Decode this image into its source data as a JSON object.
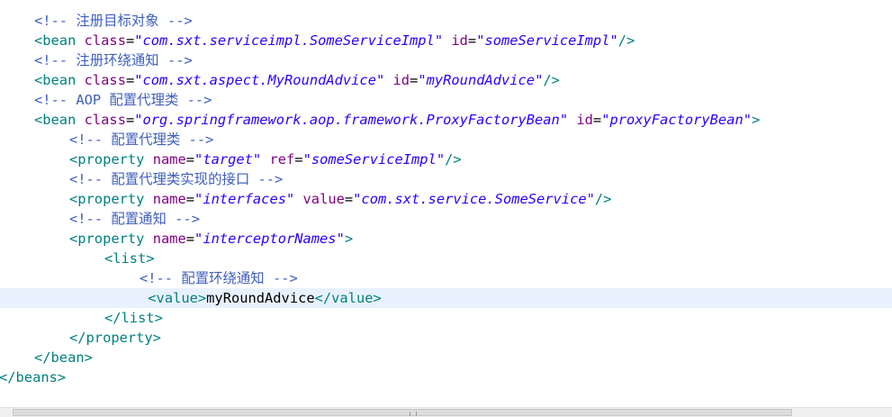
{
  "lines": [
    {
      "indent": 2,
      "segs": [
        {
          "k": "c",
          "t": "<!-- 注册目标对象 -->"
        }
      ]
    },
    {
      "indent": 2,
      "segs": [
        {
          "k": "t",
          "t": "<bean"
        },
        {
          "k": "x",
          "t": " "
        },
        {
          "k": "a",
          "t": "class"
        },
        {
          "k": "x",
          "t": "="
        },
        {
          "k": "v",
          "t": "\"com.sxt.serviceimpl.SomeServiceImpl\""
        },
        {
          "k": "x",
          "t": " "
        },
        {
          "k": "a",
          "t": "id"
        },
        {
          "k": "x",
          "t": "="
        },
        {
          "k": "v",
          "t": "\"someServiceImpl\""
        },
        {
          "k": "t",
          "t": "/>"
        }
      ]
    },
    {
      "indent": 2,
      "segs": [
        {
          "k": "c",
          "t": "<!-- 注册环绕通知 -->"
        }
      ]
    },
    {
      "indent": 2,
      "segs": [
        {
          "k": "t",
          "t": "<bean"
        },
        {
          "k": "x",
          "t": " "
        },
        {
          "k": "a",
          "t": "class"
        },
        {
          "k": "x",
          "t": "="
        },
        {
          "k": "v",
          "t": "\"com.sxt.aspect.MyRoundAdvice\""
        },
        {
          "k": "x",
          "t": " "
        },
        {
          "k": "a",
          "t": "id"
        },
        {
          "k": "x",
          "t": "="
        },
        {
          "k": "v",
          "t": "\"myRoundAdvice\""
        },
        {
          "k": "t",
          "t": "/>"
        }
      ]
    },
    {
      "indent": 2,
      "segs": [
        {
          "k": "c",
          "t": "<!-- AOP 配置代理类 -->"
        }
      ]
    },
    {
      "indent": 2,
      "segs": [
        {
          "k": "t",
          "t": "<bean"
        },
        {
          "k": "x",
          "t": " "
        },
        {
          "k": "a",
          "t": "class"
        },
        {
          "k": "x",
          "t": "="
        },
        {
          "k": "v",
          "t": "\"org.springframework.aop.framework.ProxyFactoryBean\""
        },
        {
          "k": "x",
          "t": " "
        },
        {
          "k": "a",
          "t": "id"
        },
        {
          "k": "x",
          "t": "="
        },
        {
          "k": "v",
          "t": "\"proxyFactoryBean\""
        },
        {
          "k": "t",
          "t": ">"
        }
      ]
    },
    {
      "indent": 4,
      "segs": [
        {
          "k": "c",
          "t": "<!-- 配置代理类 -->"
        }
      ]
    },
    {
      "indent": 4,
      "segs": [
        {
          "k": "t",
          "t": "<property"
        },
        {
          "k": "x",
          "t": " "
        },
        {
          "k": "a",
          "t": "name"
        },
        {
          "k": "x",
          "t": "="
        },
        {
          "k": "v",
          "t": "\"target\""
        },
        {
          "k": "x",
          "t": " "
        },
        {
          "k": "a",
          "t": "ref"
        },
        {
          "k": "x",
          "t": "="
        },
        {
          "k": "v",
          "t": "\"someServiceImpl\""
        },
        {
          "k": "t",
          "t": "/>"
        }
      ]
    },
    {
      "indent": 4,
      "segs": [
        {
          "k": "c",
          "t": "<!-- 配置代理类实现的接口 -->"
        }
      ]
    },
    {
      "indent": 4,
      "segs": [
        {
          "k": "t",
          "t": "<property"
        },
        {
          "k": "x",
          "t": " "
        },
        {
          "k": "a",
          "t": "name"
        },
        {
          "k": "x",
          "t": "="
        },
        {
          "k": "v",
          "t": "\"interfaces\""
        },
        {
          "k": "x",
          "t": " "
        },
        {
          "k": "a",
          "t": "value"
        },
        {
          "k": "x",
          "t": "="
        },
        {
          "k": "v",
          "t": "\"com.sxt.service.SomeService\""
        },
        {
          "k": "t",
          "t": "/>"
        }
      ]
    },
    {
      "indent": 4,
      "segs": [
        {
          "k": "c",
          "t": "<!-- 配置通知 -->"
        }
      ]
    },
    {
      "indent": 4,
      "segs": [
        {
          "k": "t",
          "t": "<property"
        },
        {
          "k": "x",
          "t": " "
        },
        {
          "k": "a",
          "t": "name"
        },
        {
          "k": "x",
          "t": "="
        },
        {
          "k": "v",
          "t": "\"interceptorNames\""
        },
        {
          "k": "t",
          "t": ">"
        }
      ]
    },
    {
      "indent": 6,
      "segs": [
        {
          "k": "t",
          "t": "<list>"
        }
      ]
    },
    {
      "indent": 8,
      "segs": [
        {
          "k": "c",
          "t": "<!-- 配置环绕通知 -->"
        }
      ]
    },
    {
      "indent": 8,
      "highlight": true,
      "segs": [
        {
          "k": "x",
          "t": " "
        },
        {
          "k": "t",
          "t": "<value>"
        },
        {
          "k": "x",
          "t": "myRoundAdvice"
        },
        {
          "k": "t",
          "t": "</value>"
        }
      ]
    },
    {
      "indent": 6,
      "segs": [
        {
          "k": "t",
          "t": "</list>"
        }
      ]
    },
    {
      "indent": 4,
      "segs": [
        {
          "k": "t",
          "t": "</property>"
        }
      ]
    },
    {
      "indent": 2,
      "segs": [
        {
          "k": "t",
          "t": "</bean>"
        }
      ]
    },
    {
      "indent": 0,
      "segs": [
        {
          "k": "t",
          "t": "</beans>"
        }
      ]
    }
  ],
  "colors": {
    "tag": "#008080",
    "attribute": "#7f007f",
    "value": "#2a00ff",
    "comment": "#3f5fbf",
    "text": "#000000",
    "current_line": "#e8f2fe"
  }
}
